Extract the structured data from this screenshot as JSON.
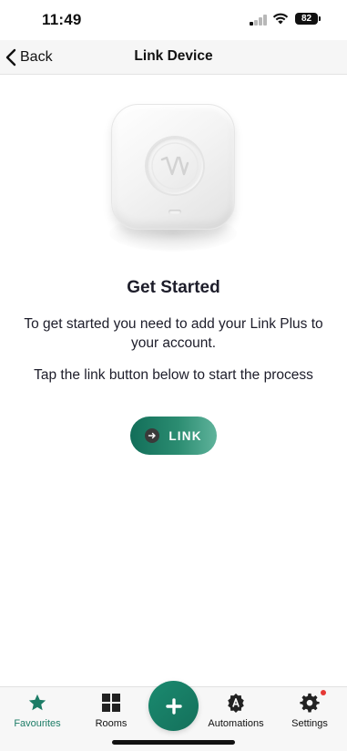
{
  "status_bar": {
    "time": "11:49",
    "battery": "82"
  },
  "nav": {
    "back_label": "Back",
    "title": "Link Device"
  },
  "content": {
    "heading": "Get Started",
    "paragraph_1": "To get started you need to add your Link Plus to your account.",
    "paragraph_2": "Tap the link button below to start the process",
    "link_button_label": "LINK"
  },
  "tab_bar": {
    "items": [
      {
        "label": "Favourites",
        "icon": "star-icon",
        "active": true
      },
      {
        "label": "Rooms",
        "icon": "grid-icon",
        "active": false
      },
      {
        "label": "Automations",
        "icon": "automation-badge-icon",
        "active": false
      },
      {
        "label": "Settings",
        "icon": "gear-icon",
        "active": false,
        "badge": true
      }
    ],
    "add_icon": "plus-icon"
  },
  "colors": {
    "accent": "#1c7c66",
    "badge": "#e53935"
  }
}
